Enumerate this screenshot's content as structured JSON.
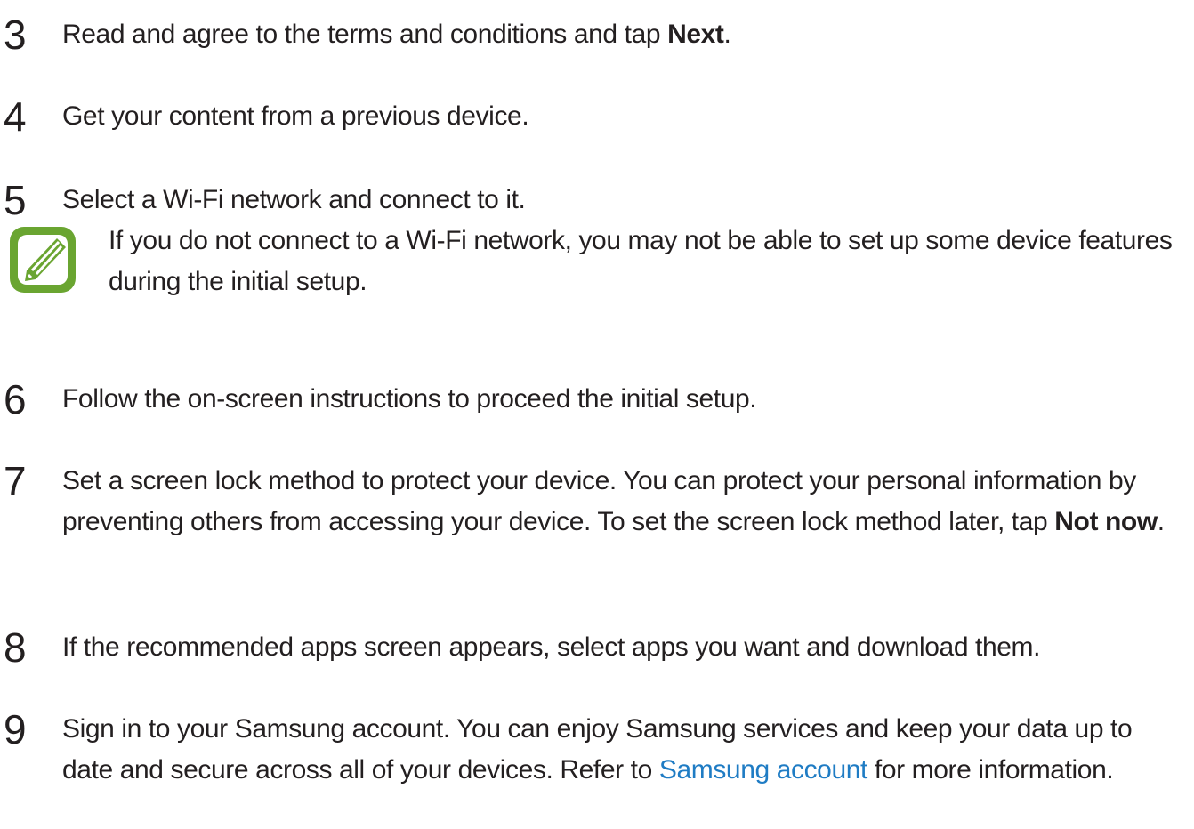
{
  "steps": [
    {
      "number": "3",
      "parts": [
        "Read and agree to the terms and conditions and tap ",
        "Next",
        "."
      ]
    },
    {
      "number": "4",
      "text": "Get your content from a previous device."
    },
    {
      "number": "5",
      "text": "Select a Wi-Fi network and connect to it."
    },
    {
      "number": "6",
      "text": "Follow the on-screen instructions to proceed the initial setup."
    },
    {
      "number": "7",
      "parts": [
        "Set a screen lock method to protect your device. You can protect your personal information by preventing others from accessing your device. To set the screen lock method later, tap ",
        "Not now",
        "."
      ]
    },
    {
      "number": "8",
      "text": "If the recommended apps screen appears, select apps you want and download them."
    },
    {
      "number": "9",
      "parts": [
        "Sign in to your Samsung account. You can enjoy Samsung services and keep your data up to date and secure across all of your devices. Refer to ",
        "Samsung account",
        " for more information."
      ]
    }
  ],
  "note": {
    "icon": "note-pencil-icon",
    "icon_color": "#6aa531",
    "text": "If you do not connect to a Wi-Fi network, you may not be able to set up some device features during the initial setup."
  },
  "colors": {
    "text": "#231f20",
    "link": "#1f7cc4"
  }
}
